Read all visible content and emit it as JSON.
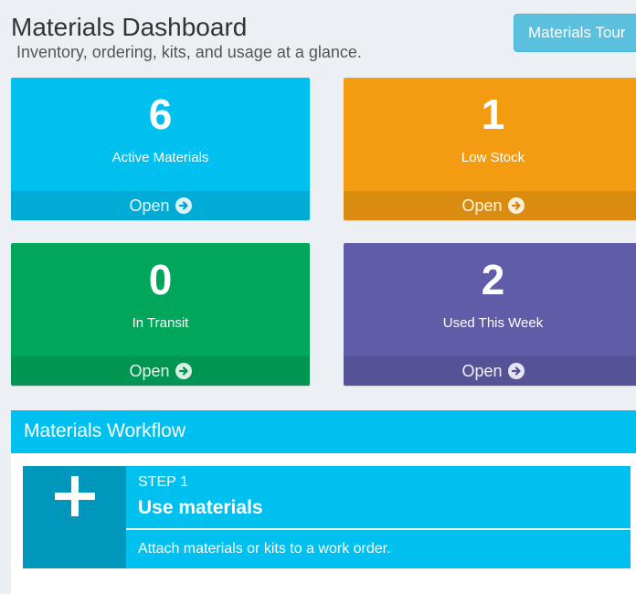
{
  "header": {
    "title": "Materials Dashboard",
    "subtitle": "Inventory, ordering, kits, and usage at a glance.",
    "tour_button": "Materials Tour"
  },
  "tiles": [
    {
      "count": "6",
      "label": "Active Materials",
      "link": "Open",
      "color": "#00c0ef"
    },
    {
      "count": "1",
      "label": "Low Stock",
      "link": "Open",
      "color": "#f39c12"
    },
    {
      "count": "0",
      "label": "In Transit",
      "link": "Open",
      "color": "#00a65a"
    },
    {
      "count": "2",
      "label": "Used This Week",
      "link": "Open",
      "color": "#605ca8"
    }
  ],
  "workflow": {
    "title": "Materials Workflow",
    "steps": [
      {
        "step_label": "STEP 1",
        "title": "Use materials",
        "description": "Attach materials or kits to a work order.",
        "icon": "plus-icon"
      }
    ]
  }
}
